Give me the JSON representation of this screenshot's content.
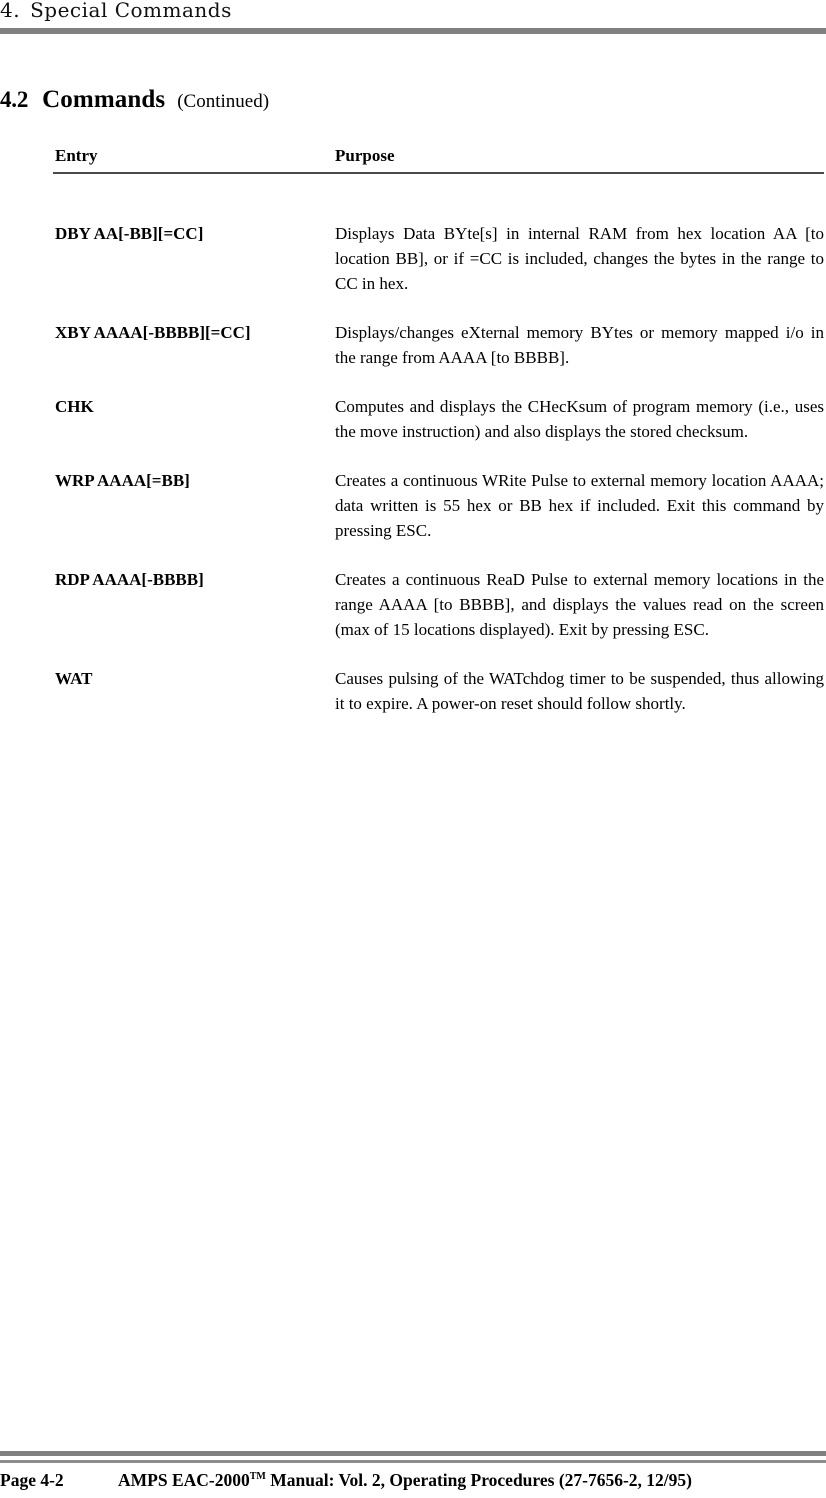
{
  "running_head": {
    "number": "4.",
    "title": "Special Commands"
  },
  "section": {
    "number": "4.2",
    "name": "Commands",
    "continued": "(Continued)"
  },
  "table": {
    "headers": {
      "entry": "Entry",
      "purpose": "Purpose"
    },
    "rows": [
      {
        "entry": "DBY AA[-BB][=CC]",
        "purpose": "Displays Data BYte[s] in internal RAM from hex location AA [to location BB], or if =CC is included, changes the bytes in the range to CC in hex."
      },
      {
        "entry": "XBY AAAA[-BBBB][=CC]",
        "purpose": "Displays/changes eXternal memory BYtes or memory mapped i/o in the range from AAAA [to BBBB]."
      },
      {
        "entry": "CHK",
        "purpose": "Computes and displays the CHecKsum of program memory (i.e., uses the move instruction) and also displays the stored checksum."
      },
      {
        "entry": "WRP AAAA[=BB]",
        "purpose": "Creates a continuous WRite Pulse to external memory location AAAA; data written is 55 hex or BB hex if included.  Exit this command by pressing ESC."
      },
      {
        "entry": "RDP AAAA[-BBBB]",
        "purpose": "Creates a continuous ReaD Pulse to external memory locations in the range AAAA [to BBBB], and displays the values read on the screen (max of 15 locations displayed). Exit by pressing ESC."
      },
      {
        "entry": "WAT",
        "purpose": "Causes pulsing of the WATchdog timer to be suspended, thus allowing it to expire.  A power-on reset should follow shortly."
      }
    ]
  },
  "footer": {
    "page_label": "Page 4-2",
    "doc_prefix": "AMPS EAC-2000",
    "trademark": "TM",
    "doc_suffix": " Manual:  Vol. 2, Operating Procedures (27-7656-2, 12/95)"
  },
  "colors": {
    "rule_gray": "#808080",
    "rule_black": "#4a4a4a",
    "text": "#000000"
  }
}
